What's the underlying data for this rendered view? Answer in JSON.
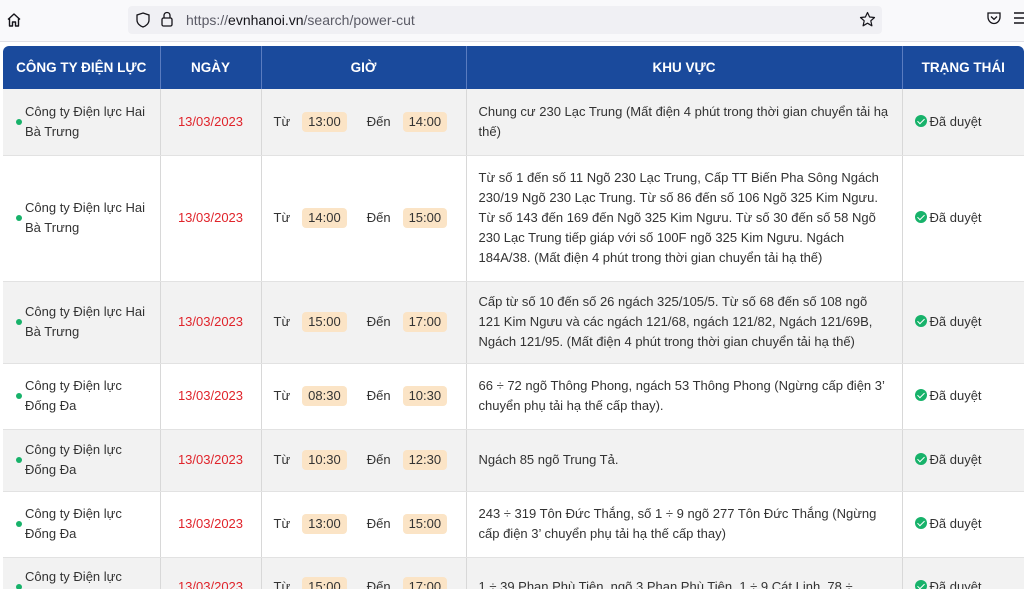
{
  "browser": {
    "url_prefix": "https://",
    "url_host": "evnhanoi.vn",
    "url_path": "/search/power-cut"
  },
  "table": {
    "headers": [
      "CÔNG TY ĐIỆN LỰC",
      "NGÀY",
      "GIỜ",
      "KHU VỰC",
      "TRẠNG THÁI"
    ],
    "from_label": "Từ",
    "to_label": "Đến",
    "rows": [
      {
        "company": "Công ty Điện lực Hai Bà Trưng",
        "date": "13/03/2023",
        "from": "13:00",
        "to": "14:00",
        "area": "Chung cư 230 Lạc Trung (Mất điện 4 phút trong thời gian chuyển tải hạ thế)",
        "status": "Đã duyệt"
      },
      {
        "company": "Công ty Điện lực Hai Bà Trưng",
        "date": "13/03/2023",
        "from": "14:00",
        "to": "15:00",
        "area": "Từ số 1 đến số 11 Ngõ 230 Lạc Trung, Cấp TT Biến Pha Sông Ngách 230/19 Ngõ 230 Lạc Trung. Từ số 86 đến số 106 Ngõ 325 Kim Ngưu. Từ số 143 đến 169 đến Ngõ 325 Kim Ngưu. Từ số 30 đến số 58 Ngõ 230 Lạc Trung tiếp giáp với số 100F ngõ 325 Kim Ngưu. Ngách 184A/38. (Mất điện 4 phút trong thời gian chuyển tải hạ thế)",
        "status": "Đã duyệt"
      },
      {
        "company": "Công ty Điện lực Hai Bà Trưng",
        "date": "13/03/2023",
        "from": "15:00",
        "to": "17:00",
        "area": "Cấp từ số 10 đến số 26 ngách 325/105/5. Từ số 68 đến số 108 ngõ 121 Kim Ngưu và các ngách 121/68, ngách 121/82, Ngách 121/69B, Ngách 121/95. (Mất điện 4 phút trong thời gian chuyển tải hạ thế)",
        "status": "Đã duyệt"
      },
      {
        "company": "Công ty Điện lực Đống Đa",
        "date": "13/03/2023",
        "from": "08:30",
        "to": "10:30",
        "area": "66 ÷ 72 ngõ Thông Phong, ngách 53 Thông Phong (Ngừng cấp điện 3’ chuyển phụ tải hạ thế cấp thay).",
        "status": "Đã duyệt"
      },
      {
        "company": "Công ty Điện lực Đống Đa",
        "date": "13/03/2023",
        "from": "10:30",
        "to": "12:30",
        "area": "Ngách 85 ngõ Trung Tả.",
        "status": "Đã duyệt"
      },
      {
        "company": "Công ty Điện lực Đống Đa",
        "date": "13/03/2023",
        "from": "13:00",
        "to": "15:00",
        "area": "243 ÷ 319 Tôn Đức Thắng, số 1 ÷ 9 ngõ 277 Tôn Đức Thắng (Ngừng cấp điện 3’ chuyển phụ tải hạ thế cấp thay)",
        "status": "Đã duyệt"
      },
      {
        "company": "Công ty Điện lực Đống Đa",
        "date": "13/03/2023",
        "from": "15:00",
        "to": "17:00",
        "area": "1 ÷ 39 Phan Phù Tiên, ngõ 3 Phan Phù Tiên, 1 ÷ 9 Cát Linh, 78 ÷",
        "status": "Đã duyệt"
      }
    ]
  },
  "colors": {
    "header_bg": "#1a4a9c",
    "date_red": "#e0242b",
    "time_pill": "#fbe4c6",
    "status_green": "#17b26a"
  },
  "icons": [
    "home-icon",
    "shield-icon",
    "lock-icon",
    "star-icon",
    "pocket-icon",
    "menu-icon",
    "status-dot-icon",
    "check-circle-icon"
  ]
}
